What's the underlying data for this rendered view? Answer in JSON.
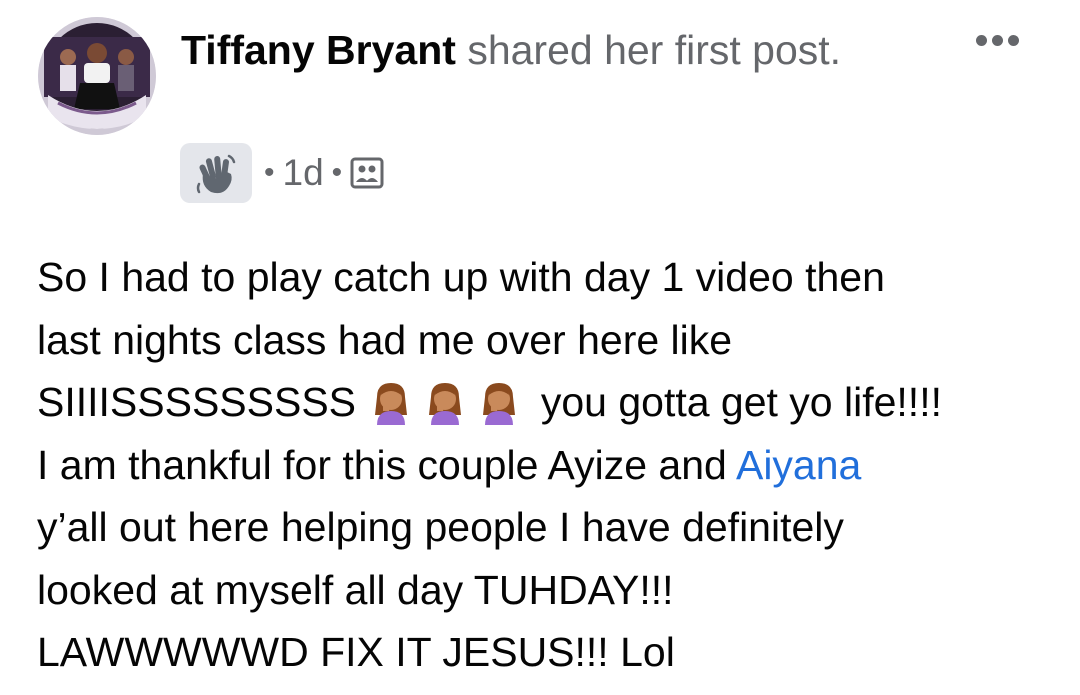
{
  "post": {
    "author": "Tiffany Bryant",
    "action": "shared her first post.",
    "time": "1d",
    "meta_separator": "•",
    "badge_icon": "waving-hand-icon",
    "audience_icon": "photo-group-icon",
    "more_icon": "more-options-icon"
  },
  "body": {
    "line1": "So I had to play catch up with day 1 video then",
    "line2": "last nights class had me over here like",
    "line3_start": "SIIIISSSSSSSSS",
    "line3_emoji": [
      "woman-facepalming-emoji",
      "woman-facepalming-emoji",
      "woman-facepalming-emoji"
    ],
    "line3_end": "you gotta get yo life!!!!",
    "line4_start": "I am thankful for this couple Ayize and",
    "mention": "Aiyana",
    "line5": "y’all out here helping people I have definitely",
    "line6": "looked at myself all day TUHDAY!!!",
    "line7": "LAWWWWWD FIX IT JESUS!!! Lol"
  },
  "colors": {
    "text": "#050505",
    "secondary": "#65676b",
    "link": "#216fdb",
    "badge_bg": "#e4e6eb"
  }
}
